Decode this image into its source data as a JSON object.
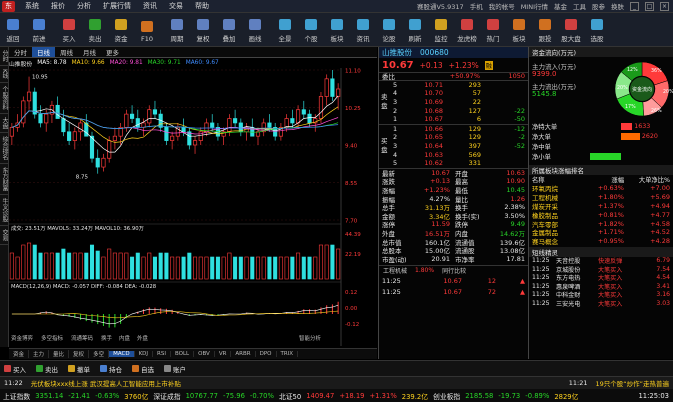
{
  "menu": {
    "items": [
      "系统",
      "报价",
      "分析",
      "扩展行情",
      "资讯",
      "交易",
      "帮助"
    ],
    "status": "赛股通V5.9317",
    "user_items": [
      "手机",
      "我的帐号",
      "MINI行情",
      "基金",
      "工具",
      "股参",
      "换肤"
    ]
  },
  "toolbar": {
    "buttons": [
      "返回",
      "前进",
      "买入",
      "卖出",
      "资金",
      "F10",
      "周期",
      "复权",
      "叠加",
      "画线",
      "全景",
      "个股",
      "板块",
      "资讯",
      "论股",
      "刷新",
      "监控",
      "龙虎榜",
      "热门",
      "板块",
      "跟投",
      "股大盘",
      "选股",
      "研报",
      "财务",
      "深港",
      "千股千评",
      "行情",
      "东方财富",
      "自选",
      "短线",
      "设置"
    ]
  },
  "left_strip": [
    "分时",
    "K线",
    "个股资料",
    "大盘",
    "综合排名",
    "东方财富",
    "牛叉诊股",
    "交易"
  ],
  "chart": {
    "tabs": [
      "分时",
      "日线",
      "周线",
      "月线",
      "更多"
    ],
    "active_tab": "日线",
    "info": {
      "name": "山推股份",
      "ma5": "MA5: 8.78",
      "ma10": "MA10: 9.66",
      "ma20": "MA20: 9.81",
      "ma30": "MA30: 9.71",
      "ma60": "MA60: 9.67",
      "ma120": "MA120: 9.54"
    },
    "price_axis": [
      "11.10",
      "10.25",
      "9.40",
      "8.55",
      "7.70"
    ],
    "peak_label": "10.95",
    "low_label": "8.75",
    "vol_info": "成交: 23.51万  MAVOL5: 33.24万  MAVOL10: 36.90万",
    "vol_axis": [
      "44.39",
      "22.19"
    ],
    "macd_info": "MACD(12,26,9)  MACD: -0.057  DIFF: -0.084  DEA: -0.028",
    "macd_axis": [
      "0.12",
      "0.00",
      "-0.12"
    ],
    "indicator_tabs": [
      "资金",
      "主力",
      "量比",
      "复权",
      "多空",
      "MACD",
      "KDJ",
      "RSI",
      "BOLL",
      "OBV",
      "VR",
      "ARBR",
      "DPO",
      "TRIX"
    ],
    "active_indicator": "MACD",
    "bottom_tabs": [
      "资金博弈",
      "多空指标",
      "流通筹码",
      "换手",
      "内盘",
      "外盘"
    ],
    "last_label": "智能分析"
  },
  "chart_data": {
    "type": "candlestick",
    "price_range": [
      7.7,
      11.1
    ],
    "candles": [
      [
        9.6,
        9.9,
        9.4,
        9.8
      ],
      [
        9.8,
        10.1,
        9.7,
        9.9
      ],
      [
        9.9,
        10.5,
        9.8,
        10.4
      ],
      [
        10.4,
        10.95,
        10.2,
        10.6
      ],
      [
        10.6,
        10.7,
        10.0,
        10.1
      ],
      [
        10.1,
        10.3,
        9.8,
        9.9
      ],
      [
        9.9,
        10.2,
        9.7,
        10.1
      ],
      [
        10.1,
        10.4,
        9.9,
        10.3
      ],
      [
        10.3,
        10.5,
        10.0,
        10.0
      ],
      [
        10.0,
        10.2,
        9.6,
        9.7
      ],
      [
        9.7,
        9.9,
        9.4,
        9.5
      ],
      [
        9.5,
        9.8,
        9.3,
        9.7
      ],
      [
        9.7,
        10.0,
        9.5,
        9.9
      ],
      [
        9.9,
        10.1,
        9.6,
        9.6
      ],
      [
        9.6,
        9.7,
        9.0,
        9.1
      ],
      [
        9.1,
        9.3,
        8.75,
        8.9
      ],
      [
        8.9,
        9.2,
        8.8,
        9.1
      ],
      [
        9.1,
        9.6,
        9.0,
        9.5
      ],
      [
        9.5,
        9.8,
        9.3,
        9.6
      ],
      [
        9.6,
        9.9,
        9.4,
        9.8
      ],
      [
        9.8,
        10.2,
        9.7,
        10.1
      ],
      [
        10.1,
        10.3,
        9.9,
        10.0
      ],
      [
        10.0,
        10.2,
        9.7,
        9.8
      ],
      [
        9.8,
        10.0,
        9.6,
        9.9
      ],
      [
        9.9,
        10.3,
        9.8,
        10.2
      ],
      [
        10.2,
        10.4,
        10.0,
        10.1
      ],
      [
        10.1,
        10.2,
        9.7,
        9.8
      ],
      [
        9.8,
        9.9,
        9.4,
        9.5
      ],
      [
        9.5,
        9.7,
        9.3,
        9.6
      ],
      [
        9.6,
        9.9,
        9.5,
        9.8
      ],
      [
        9.8,
        10.0,
        9.6,
        9.7
      ],
      [
        9.7,
        9.8,
        9.3,
        9.4
      ],
      [
        9.4,
        9.6,
        9.2,
        9.5
      ],
      [
        9.5,
        9.8,
        9.4,
        9.7
      ],
      [
        9.7,
        10.0,
        9.6,
        9.9
      ],
      [
        9.9,
        10.1,
        9.7,
        9.8
      ],
      [
        9.8,
        9.9,
        9.5,
        9.6
      ],
      [
        9.6,
        9.8,
        9.4,
        9.7
      ],
      [
        9.7,
        10.1,
        9.6,
        10.0
      ],
      [
        10.0,
        10.2,
        9.8,
        9.9
      ],
      [
        9.9,
        10.0,
        9.6,
        9.7
      ],
      [
        9.7,
        9.9,
        9.5,
        9.8
      ],
      [
        9.8,
        10.0,
        9.6,
        9.6
      ],
      [
        9.6,
        9.8,
        9.4,
        9.7
      ],
      [
        9.7,
        10.0,
        9.6,
        9.9
      ],
      [
        9.9,
        10.1,
        9.7,
        9.8
      ],
      [
        9.8,
        9.9,
        9.5,
        9.6
      ],
      [
        9.6,
        9.9,
        9.5,
        9.8
      ],
      [
        9.8,
        10.1,
        9.7,
        10.0
      ],
      [
        10.0,
        10.2,
        9.8,
        9.9
      ],
      [
        9.9,
        10.3,
        9.8,
        10.2
      ],
      [
        10.2,
        10.4,
        10.0,
        10.1
      ],
      [
        10.1,
        10.2,
        9.8,
        9.9
      ],
      [
        9.9,
        10.1,
        9.7,
        10.0
      ],
      [
        10.0,
        10.6,
        9.9,
        10.5
      ],
      [
        10.5,
        11.0,
        10.3,
        10.9
      ],
      [
        10.9,
        11.1,
        10.4,
        10.5
      ],
      [
        10.5,
        10.8,
        10.2,
        10.67
      ]
    ]
  },
  "quote": {
    "name": "山推股份",
    "code": "000680",
    "price": "10.67",
    "change": "+0.13",
    "pct": "+1.23%",
    "badge": "融",
    "weibi_label": "委比",
    "weibi": "+50.97%",
    "weicha": "1050",
    "sell_label": "卖盘",
    "buy_label": "买盘",
    "sells": [
      {
        "lvl": "5",
        "price": "10.71",
        "vol": "293",
        "chg": ""
      },
      {
        "lvl": "4",
        "price": "10.70",
        "vol": "57",
        "chg": ""
      },
      {
        "lvl": "3",
        "price": "10.69",
        "vol": "22",
        "chg": ""
      },
      {
        "lvl": "2",
        "price": "10.68",
        "vol": "127",
        "chg": "-22"
      },
      {
        "lvl": "1",
        "price": "10.67",
        "vol": "6",
        "chg": "-50"
      }
    ],
    "buys": [
      {
        "lvl": "1",
        "price": "10.66",
        "vol": "129",
        "chg": "-12"
      },
      {
        "lvl": "2",
        "price": "10.65",
        "vol": "129",
        "chg": "-2"
      },
      {
        "lvl": "3",
        "price": "10.64",
        "vol": "397",
        "chg": "-52"
      },
      {
        "lvl": "4",
        "price": "10.63",
        "vol": "569",
        "chg": ""
      },
      {
        "lvl": "5",
        "price": "10.62",
        "vol": "331",
        "chg": ""
      }
    ],
    "stats": [
      {
        "k1": "最新",
        "v1": "10.67",
        "c1": "red",
        "k2": "开盘",
        "v2": "10.63",
        "c2": "red"
      },
      {
        "k1": "涨跌",
        "v1": "+0.13",
        "c1": "red",
        "k2": "最高",
        "v2": "10.90",
        "c2": "red"
      },
      {
        "k1": "涨幅",
        "v1": "+1.23%",
        "c1": "red",
        "k2": "最低",
        "v2": "10.45",
        "c2": "green"
      },
      {
        "k1": "振幅",
        "v1": "4.27%",
        "c1": "white",
        "k2": "量比",
        "v2": "1.26",
        "c2": "red"
      },
      {
        "k1": "总手",
        "v1": "31.13万",
        "c1": "yellow",
        "k2": "换手",
        "v2": "2.38%",
        "c2": "white"
      },
      {
        "k1": "金额",
        "v1": "3.34亿",
        "c1": "yellow",
        "k2": "换手(实)",
        "v2": "3.50%",
        "c2": "white"
      },
      {
        "k1": "涨停",
        "v1": "11.59",
        "c1": "red",
        "k2": "跌停",
        "v2": "9.49",
        "c2": "green"
      },
      {
        "k1": "外盘",
        "v1": "16.51万",
        "c1": "red",
        "k2": "内盘",
        "v2": "14.62万",
        "c2": "green"
      },
      {
        "k1": "总市值",
        "v1": "160.1亿",
        "c1": "white",
        "k2": "流通值",
        "v2": "139.6亿",
        "c2": "white"
      },
      {
        "k1": "总股本",
        "v1": "15.00亿",
        "c1": "white",
        "k2": "流通股",
        "v2": "13.08亿",
        "c2": "white"
      },
      {
        "k1": "市盈(动)",
        "v1": "20.91",
        "c1": "white",
        "k2": "市净率",
        "v2": "17.81",
        "c2": "white"
      }
    ],
    "tick_tabs": [
      "工程机械",
      "1.80%",
      "同行比较"
    ],
    "ticks": [
      {
        "time": "11:25",
        "price": "10.67",
        "vol": "12",
        "dir": "up"
      },
      {
        "time": "11:25",
        "price": "10.67",
        "vol": "72",
        "dir": "up"
      }
    ]
  },
  "flow": {
    "title": "资金流向(万元)",
    "in_label": "主力流入(万元)",
    "in_value": "9399.0",
    "out_label": "主力流出(万元)",
    "out_value": "5145.8",
    "donut_center": "资金流向",
    "donut_pct": [
      "36%",
      "20%",
      "26%",
      "17%",
      "20%",
      "12%"
    ],
    "bars": [
      {
        "label": "净特大单",
        "value": "1633",
        "color": "#ff3a3a",
        "frac": 0.25
      },
      {
        "label": "净大单",
        "value": "2620",
        "color": "#ff6a00",
        "frac": 0.42
      },
      {
        "label": "净中单",
        "value": "",
        "color": "#28d628",
        "frac": 0.0
      },
      {
        "label": "净小单",
        "value": "-4338",
        "color": "#28d628",
        "frac": 0.7
      }
    ],
    "sector_title": "所属板块涨幅排名",
    "sector_head": [
      "名称",
      "涨幅",
      "大单净比%"
    ],
    "sectors": [
      {
        "name": "环氧丙烷",
        "pct": "+0.63%",
        "net": "+7.00"
      },
      {
        "name": "工程机械",
        "pct": "+1.80%",
        "net": "+5.69"
      },
      {
        "name": "煤炭开采",
        "pct": "+1.37%",
        "net": "+4.94"
      },
      {
        "name": "橡胶制品",
        "pct": "+0.81%",
        "net": "+4.77"
      },
      {
        "name": "汽车零部",
        "pct": "+1.82%",
        "net": "+4.58"
      },
      {
        "name": "金属制品",
        "pct": "+1.71%",
        "net": "+4.52"
      },
      {
        "name": "赛马概念",
        "pct": "+0.95%",
        "net": "+4.28"
      }
    ],
    "news_title": "短线精灵",
    "news": [
      {
        "time": "11:25",
        "name": "天音控股",
        "tag": "快速反弹",
        "val": "6.79"
      },
      {
        "time": "11:25",
        "name": "京城股份",
        "tag": "大笔买入",
        "val": "7.54"
      },
      {
        "time": "11:25",
        "name": "东方电热",
        "tag": "大笔买入",
        "val": "4.54"
      },
      {
        "time": "11:25",
        "name": "惠泉啤酒",
        "tag": "大笔买入",
        "val": "3.41"
      },
      {
        "time": "11:25",
        "name": "中科金财",
        "tag": "大笔买入",
        "val": "3.16"
      },
      {
        "time": "11:25",
        "name": "三安光电",
        "tag": "大笔买入",
        "val": "3.03"
      }
    ]
  },
  "funcbar": [
    "买入",
    "卖出",
    "撤单",
    "持仓",
    "自选",
    "账户"
  ],
  "ticker": {
    "news1_time": "11:22",
    "news1": "光伏板块xxx线上涨 武汉提高人工智能应用上市补贴",
    "news2_time": "11:21",
    "news2": "19只个股“炒作”走热普遍"
  },
  "indices": [
    {
      "name": "上证指数",
      "val": "3351.14",
      "chg": "-21.41",
      "pct": "-0.63%",
      "amt": "3760亿",
      "cls": "green"
    },
    {
      "name": "深证成指",
      "val": "10767.77",
      "chg": "-75.96",
      "pct": "-0.70%",
      "amt": "",
      "cls": "green"
    },
    {
      "name": "北证50",
      "val": "1409.47",
      "chg": "+18.19",
      "pct": "+1.31%",
      "amt": "239.2亿",
      "cls": "red"
    },
    {
      "name": "创业板指",
      "val": "2185.58",
      "chg": "-19.73",
      "pct": "-0.89%",
      "amt": "2829亿",
      "cls": "green"
    }
  ],
  "clock": "11:25:03"
}
